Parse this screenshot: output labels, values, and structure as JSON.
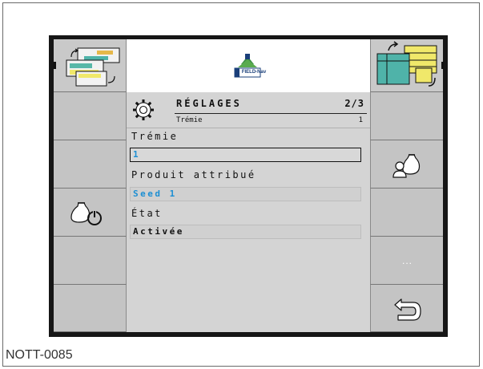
{
  "caption": "NOTT-0085",
  "header": {
    "logo_text": "FIELD-Nav"
  },
  "screen": {
    "title": "RÉGLAGES",
    "page": "2/3",
    "subtitle_label": "Trémie",
    "subtitle_value": "1"
  },
  "fields": [
    {
      "label": "Trémie",
      "value": "1"
    },
    {
      "label": "Produit attribué",
      "value": "Seed 1"
    },
    {
      "label": "État",
      "value": "Activée"
    }
  ],
  "softkeys": {
    "more_label": "...",
    "icons_left": [
      "layout-swap-icon",
      "",
      "",
      "bag-power-icon",
      "",
      ""
    ],
    "icons_right": [
      "layout-swap-icon",
      "",
      "user-bag-icon",
      "",
      "more-icon",
      "back-icon"
    ]
  },
  "colors": {
    "accent_blue": "#1d8fd3",
    "softkey_bg": "#c4c4c4",
    "frame_bg": "#161616"
  }
}
